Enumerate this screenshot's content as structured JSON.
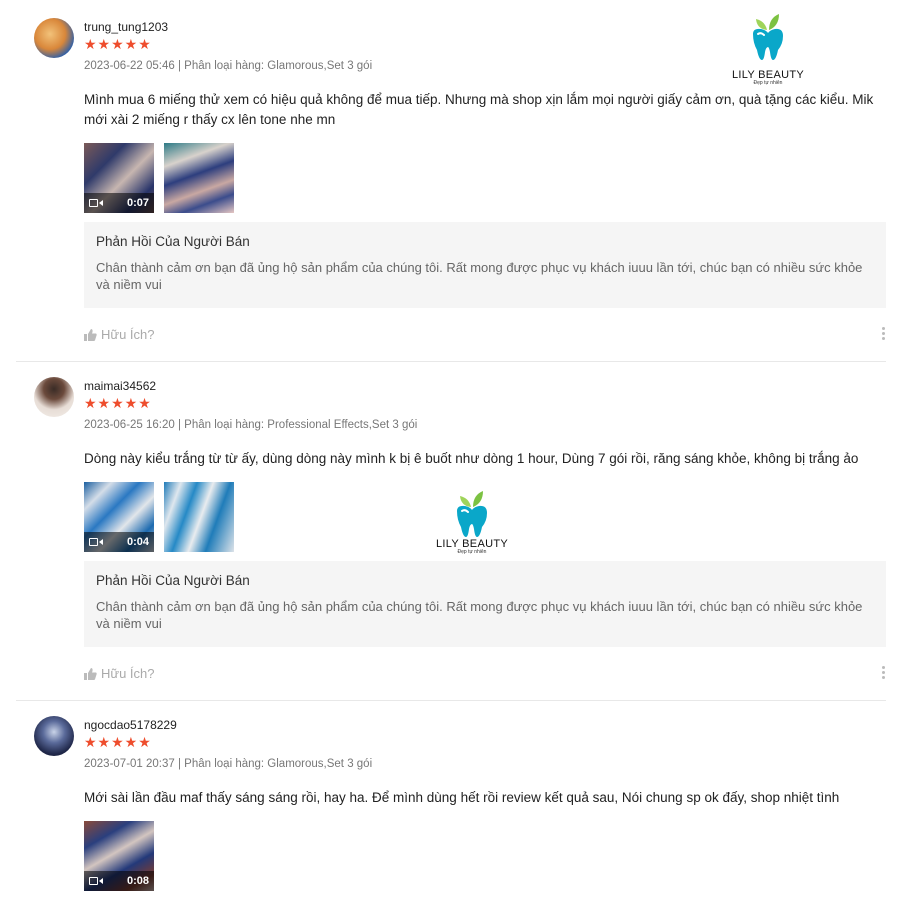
{
  "brand": {
    "name": "LILY BEAUTY",
    "tagline": "Đẹp tự nhiên",
    "primary_color": "#0aa7c9",
    "leaf_color": "#7cc242"
  },
  "colors": {
    "star": "#ee4d2d"
  },
  "reviews": [
    {
      "username": "trung_tung1203",
      "stars": "★★★★★",
      "meta": "2023-06-22 05:46 | Phân loại hàng: Glamorous,Set 3 gói",
      "comment": "Mình mua 6 miếng thử xem có hiệu quả không để mua tiếp. Nhưng mà shop xịn lắm mọi người  giấy cảm ơn, quà tặng các kiểu. Mik mới xài 2 miếng r thấy cx lên tone nhe mn",
      "video_duration": "0:07",
      "reply_title": "Phản Hồi Của Người Bán",
      "reply_text": "Chân thành cảm ơn bạn đã ủng hộ sản phẩm của chúng tôi. Rất mong được phục vụ khách iuuu lần tới, chúc bạn có nhiều sức khỏe và niềm vui",
      "helpful": "Hữu Ích?"
    },
    {
      "username": "maimai34562",
      "stars": "★★★★★",
      "meta": "2023-06-25 16:20 | Phân loại hàng: Professional Effects,Set 3 gói",
      "comment": "Dòng này kiểu trắng từ từ ấy, dùng dòng này mình k bị ê buốt như dòng 1 hour, Dùng 7 gói rồi, răng sáng khỏe, không bị trắng ảo",
      "video_duration": "0:04",
      "reply_title": "Phản Hồi Của Người Bán",
      "reply_text": "Chân thành cảm ơn bạn đã ủng hộ sản phẩm của chúng tôi. Rất mong được phục vụ khách iuuu lần tới, chúc bạn có nhiều sức khỏe và niềm vui",
      "helpful": "Hữu Ích?"
    },
    {
      "username": "ngocdao5178229",
      "stars": "★★★★★",
      "meta": "2023-07-01 20:37 | Phân loại hàng: Glamorous,Set 3 gói",
      "comment": "Mới sài lần đầu maf thấy sáng sáng rồi, hay ha. Để mình dùng hết rồi review kết quả sau, Nói chung sp ok đấy, shop nhiệt tình",
      "video_duration": "0:08"
    }
  ]
}
